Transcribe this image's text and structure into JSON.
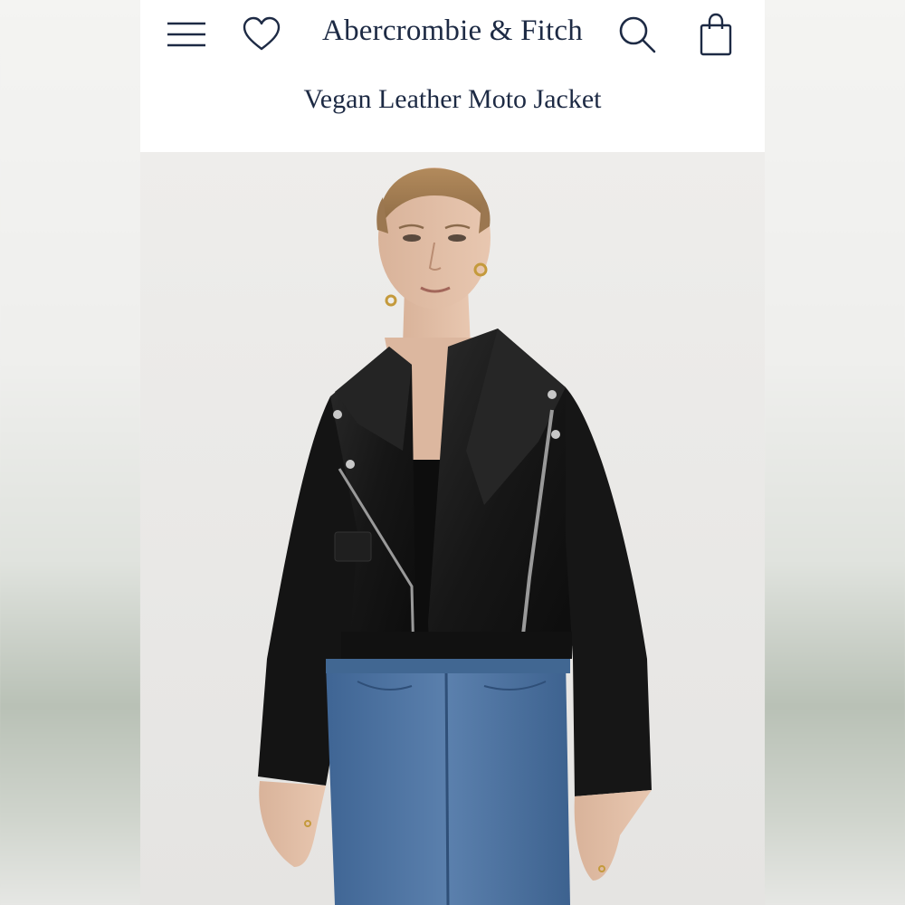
{
  "header": {
    "brand": "Abercrombie & Fitch",
    "product_title": "Vegan Leather Moto Jacket"
  },
  "icons": {
    "menu": "menu-icon",
    "wishlist": "heart-icon",
    "search": "search-icon",
    "bag": "shopping-bag-icon"
  },
  "colors": {
    "brand_navy": "#1d2a44",
    "jacket": "#1a1a1a",
    "denim": "#4a6f9e"
  }
}
